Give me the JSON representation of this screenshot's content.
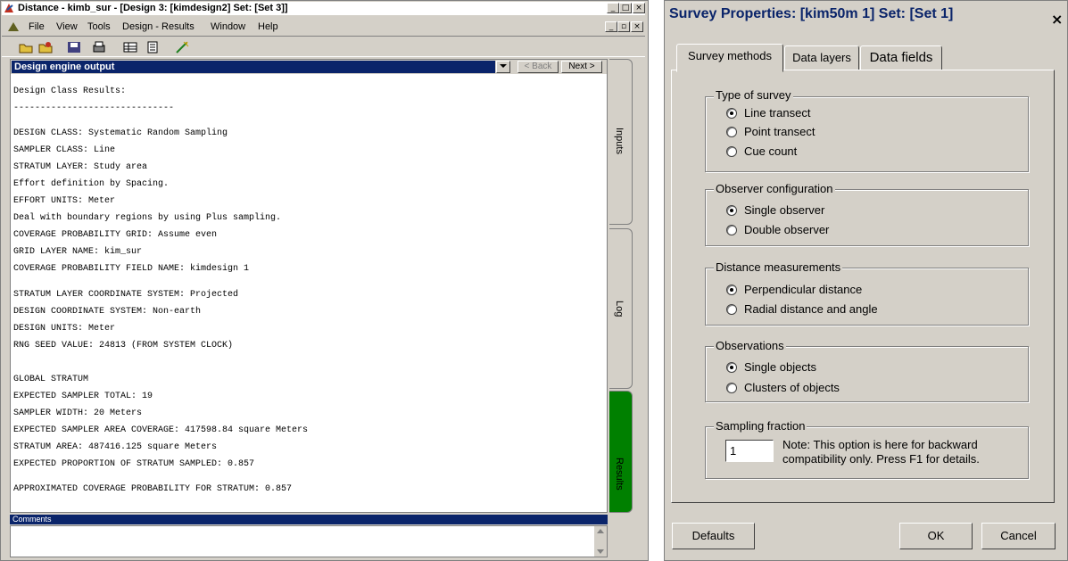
{
  "left_window": {
    "title": "Distance - kimb_sur - [Design 3: [kimdesign2] Set: [Set 3]]",
    "caption_buttons": [
      "_",
      "□",
      "×"
    ],
    "mdi_buttons": [
      "_",
      "▫",
      "×"
    ],
    "menu": [
      "File",
      "View",
      "Tools",
      "Design - Results",
      "Window",
      "Help"
    ],
    "toolbar_icons": [
      "open-folder-icon",
      "open-project-icon",
      "save-icon",
      "print-icon",
      "data-icon",
      "notes-icon",
      "wizard-icon"
    ],
    "pane_title": "Design engine output",
    "back_label": "< Back",
    "next_label": "Next >",
    "output_lines": [
      "Design Class Results:",
      "------------------------------",
      "",
      "DESIGN CLASS: Systematic Random Sampling",
      "SAMPLER CLASS: Line",
      "STRATUM LAYER: Study area",
      "Effort definition by Spacing.",
      "EFFORT UNITS: Meter",
      "Deal with boundary regions by using Plus sampling.",
      "COVERAGE PROBABILITY GRID: Assume even",
      "GRID LAYER NAME: kim_sur",
      "COVERAGE PROBABILITY FIELD NAME: kimdesign 1",
      "",
      "STRATUM LAYER COORDINATE SYSTEM: Projected",
      "DESIGN COORDINATE SYSTEM: Non-earth",
      "DESIGN UNITS: Meter",
      "RNG SEED VALUE: 24813 (FROM SYSTEM CLOCK)",
      "",
      "",
      "GLOBAL STRATUM",
      "EXPECTED SAMPLER TOTAL: 19",
      "SAMPLER WIDTH: 20 Meters",
      "EXPECTED SAMPLER AREA COVERAGE: 417598.84 square Meters",
      "STRATUM AREA: 487416.125 square Meters",
      "EXPECTED PROPORTION OF STRATUM SAMPLED: 0.857",
      "",
      "APPROXIMATED COVERAGE PROBABILITY FOR STRATUM: 0.857"
    ],
    "side_tabs": [
      "Inputs",
      "Log",
      "Results"
    ],
    "active_side_tab_color": "#008000",
    "comments_label": "Comments",
    "comments_value": ""
  },
  "dialog": {
    "title": "Survey Properties: [kim50m 1] Set: [Set 1]",
    "close": "×",
    "tabs": [
      "Survey methods",
      "Data layers",
      "Data fields"
    ],
    "groups": {
      "type_of_survey": {
        "label": "Type of survey",
        "options": [
          "Line transect",
          "Point transect",
          "Cue count"
        ],
        "selected": 0
      },
      "observer_configuration": {
        "label": "Observer configuration",
        "options": [
          "Single observer",
          "Double observer"
        ],
        "selected": 0
      },
      "distance_measurements": {
        "label": "Distance measurements",
        "options": [
          "Perpendicular distance",
          "Radial distance and angle"
        ],
        "selected": 0
      },
      "observations": {
        "label": "Observations",
        "options": [
          "Single objects",
          "Clusters of objects"
        ],
        "selected": 0
      },
      "sampling_fraction": {
        "label": "Sampling fraction",
        "value": "1",
        "note": "Note: This option is here for backward compatibility only.  Press F1 for details."
      }
    },
    "buttons": {
      "defaults": "Defaults",
      "ok": "OK",
      "cancel": "Cancel"
    }
  }
}
